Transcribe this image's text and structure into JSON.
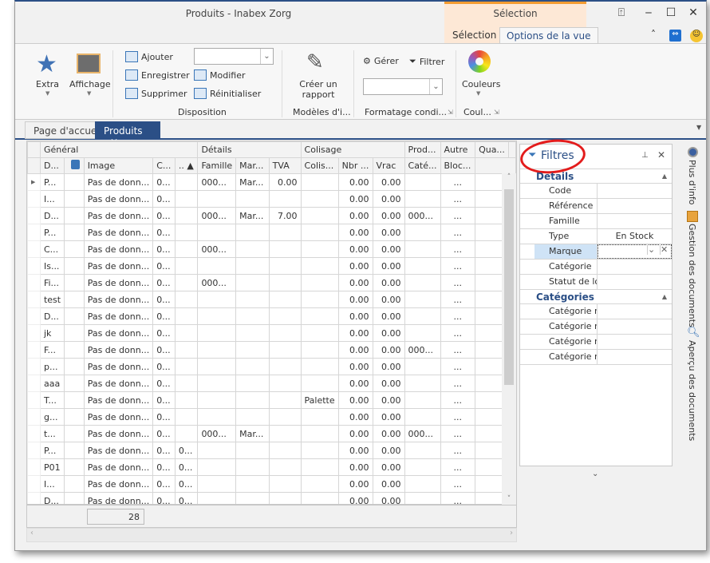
{
  "window": {
    "title": "Produits - Inabex Zorg",
    "context_group": "Sélection"
  },
  "ribbon_tabs": [
    {
      "label": "Sélection"
    },
    {
      "label": "Options de la vue",
      "active": true
    }
  ],
  "ribbon": {
    "extra": "Extra",
    "affichage": "Affichage",
    "disposition": {
      "ajouter": "Ajouter",
      "enregistrer": "Enregistrer",
      "supprimer": "Supprimer",
      "modifier": "Modifier",
      "reinitialiser": "Réinitialiser",
      "combo_value": "",
      "label": "Disposition"
    },
    "rapport": {
      "label": "Créer un rapport",
      "group": "Modèles d'i..."
    },
    "formatage": {
      "gerer": "Gérer",
      "filtrer": "Filtrer",
      "combo_value": "",
      "group": "Formatage condi..."
    },
    "couleurs": {
      "label": "Couleurs",
      "group": "Coul..."
    }
  },
  "doc_tabs": [
    {
      "label": "Page d'accueil"
    },
    {
      "label": "Produits",
      "active": true,
      "close": "✕"
    }
  ],
  "grid": {
    "bands": [
      "Général",
      "Détails",
      "Colisage",
      "Prod...",
      "Autre",
      "Qua..."
    ],
    "columns": [
      "D...",
      "",
      "Image",
      "C...",
      ".. ▲",
      "Famille",
      "Mar...",
      "TVA",
      "Colis...",
      "Nbr ...",
      "Vrac",
      "Caté...",
      "Bloc..."
    ],
    "rows": [
      [
        "P...",
        "",
        "Pas de donn...",
        "0...",
        "",
        "000...",
        "Mar...",
        "0.00",
        "",
        "0.00",
        "0.00",
        "",
        "..."
      ],
      [
        "I...",
        "",
        "Pas de donn...",
        "0...",
        "",
        "",
        "",
        "",
        "",
        "0.00",
        "0.00",
        "",
        "..."
      ],
      [
        "D...",
        "",
        "Pas de donn...",
        "0...",
        "",
        "000...",
        "Mar...",
        "7.00",
        "",
        "0.00",
        "0.00",
        "000...",
        "..."
      ],
      [
        "P...",
        "",
        "Pas de donn...",
        "0...",
        "",
        "",
        "",
        "",
        "",
        "0.00",
        "0.00",
        "",
        "..."
      ],
      [
        "C...",
        "",
        "Pas de donn...",
        "0...",
        "",
        "000...",
        "",
        "",
        "",
        "0.00",
        "0.00",
        "",
        "..."
      ],
      [
        "Is...",
        "",
        "Pas de donn...",
        "0...",
        "",
        "",
        "",
        "",
        "",
        "0.00",
        "0.00",
        "",
        "..."
      ],
      [
        "Fi...",
        "",
        "Pas de donn...",
        "0...",
        "",
        "000...",
        "",
        "",
        "",
        "0.00",
        "0.00",
        "",
        "..."
      ],
      [
        "test",
        "",
        "Pas de donn...",
        "0...",
        "",
        "",
        "",
        "",
        "",
        "0.00",
        "0.00",
        "",
        "..."
      ],
      [
        "D...",
        "",
        "Pas de donn...",
        "0...",
        "",
        "",
        "",
        "",
        "",
        "0.00",
        "0.00",
        "",
        "..."
      ],
      [
        "jk",
        "",
        "Pas de donn...",
        "0...",
        "",
        "",
        "",
        "",
        "",
        "0.00",
        "0.00",
        "",
        "..."
      ],
      [
        "F...",
        "",
        "Pas de donn...",
        "0...",
        "",
        "",
        "",
        "",
        "",
        "0.00",
        "0.00",
        "000...",
        "..."
      ],
      [
        "p...",
        "",
        "Pas de donn...",
        "0...",
        "",
        "",
        "",
        "",
        "",
        "0.00",
        "0.00",
        "",
        "..."
      ],
      [
        "aaa",
        "",
        "Pas de donn...",
        "0...",
        "",
        "",
        "",
        "",
        "",
        "0.00",
        "0.00",
        "",
        "..."
      ],
      [
        "T...",
        "",
        "Pas de donn...",
        "0...",
        "",
        "",
        "",
        "",
        "Palette",
        "0.00",
        "0.00",
        "",
        "..."
      ],
      [
        "g...",
        "",
        "Pas de donn...",
        "0...",
        "",
        "",
        "",
        "",
        "",
        "0.00",
        "0.00",
        "",
        "..."
      ],
      [
        "t...",
        "",
        "Pas de donn...",
        "0...",
        "",
        "000...",
        "Mar...",
        "",
        "",
        "0.00",
        "0.00",
        "000...",
        "..."
      ],
      [
        "P...",
        "",
        "Pas de donn...",
        "0...",
        "0...",
        "",
        "",
        "",
        "",
        "0.00",
        "0.00",
        "",
        "..."
      ],
      [
        "P01",
        "",
        "Pas de donn...",
        "0...",
        "0...",
        "",
        "",
        "",
        "",
        "0.00",
        "0.00",
        "",
        "..."
      ],
      [
        "I...",
        "",
        "Pas de donn...",
        "0...",
        "0...",
        "",
        "",
        "",
        "",
        "0.00",
        "0.00",
        "",
        "..."
      ],
      [
        "D...",
        "",
        "Pas de donn...",
        "0...",
        "0...",
        "",
        "",
        "",
        "",
        "0.00",
        "0.00",
        "",
        "..."
      ]
    ],
    "footer_count": "28"
  },
  "filters": {
    "title": "Filtres",
    "sections": [
      {
        "title": "Details",
        "fields": [
          {
            "label": "Code",
            "value": ""
          },
          {
            "label": "Référence",
            "value": ""
          },
          {
            "label": "Famille",
            "value": ""
          },
          {
            "label": "Type",
            "value": "En Stock"
          },
          {
            "label": "Marque",
            "value": "",
            "selected": true
          },
          {
            "label": "Catégorie",
            "value": ""
          },
          {
            "label": "Statut de lot",
            "value": ""
          }
        ]
      },
      {
        "title": "Catégories",
        "fields": [
          {
            "label": "Catégorie n°",
            "value": ""
          },
          {
            "label": "Catégorie n°",
            "value": ""
          },
          {
            "label": "Catégorie n°",
            "value": ""
          },
          {
            "label": "Catégorie n°",
            "value": ""
          }
        ]
      }
    ]
  },
  "side_panels": [
    {
      "label": "Plus d'info"
    },
    {
      "label": "Gestion des documents"
    },
    {
      "label": "Aperçu des documents"
    }
  ],
  "colors": {
    "accent": "#2b4f86",
    "context": "#f39c32",
    "highlight": "#e31c1c"
  }
}
